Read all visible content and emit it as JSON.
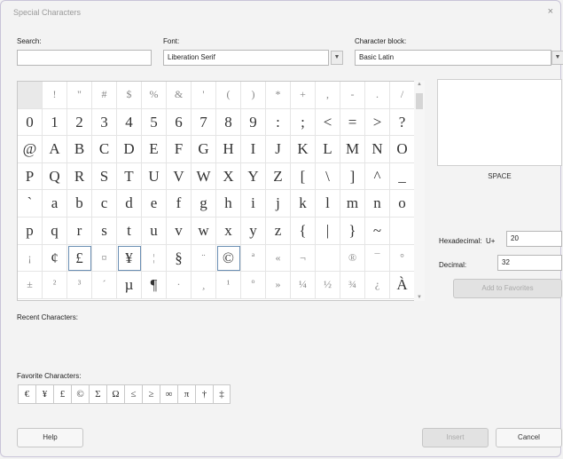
{
  "window": {
    "title": "Special Characters",
    "close_glyph": "×"
  },
  "search": {
    "label": "Search:",
    "value": ""
  },
  "font": {
    "label": "Font:",
    "value": "Liberation Serif"
  },
  "block": {
    "label": "Character block:",
    "value": "Basic Latin"
  },
  "grid": [
    [
      "",
      "!",
      "\"",
      "#",
      "$",
      "%",
      "&",
      "'",
      "(",
      ")",
      "*",
      "+",
      ",",
      "-",
      ".",
      "/"
    ],
    [
      "0",
      "1",
      "2",
      "3",
      "4",
      "5",
      "6",
      "7",
      "8",
      "9",
      ":",
      ";",
      "<",
      "=",
      ">",
      "?"
    ],
    [
      "@",
      "A",
      "B",
      "C",
      "D",
      "E",
      "F",
      "G",
      "H",
      "I",
      "J",
      "K",
      "L",
      "M",
      "N",
      "O"
    ],
    [
      "P",
      "Q",
      "R",
      "S",
      "T",
      "U",
      "V",
      "W",
      "X",
      "Y",
      "Z",
      "[",
      "\\",
      "]",
      "^",
      "_"
    ],
    [
      "`",
      "a",
      "b",
      "c",
      "d",
      "e",
      "f",
      "g",
      "h",
      "i",
      "j",
      "k",
      "l",
      "m",
      "n",
      "o"
    ],
    [
      "p",
      "q",
      "r",
      "s",
      "t",
      "u",
      "v",
      "w",
      "x",
      "y",
      "z",
      "{",
      "|",
      "}",
      "~",
      ""
    ],
    [
      "¡",
      "¢",
      "£",
      "¤",
      "¥",
      "¦",
      "§",
      "¨",
      "©",
      "ª",
      "«",
      "¬",
      "",
      "®",
      "¯",
      "°"
    ],
    [
      "±",
      "²",
      "³",
      "´",
      "µ",
      "¶",
      "·",
      "¸",
      "¹",
      "º",
      "»",
      "¼",
      "½",
      "¾",
      "¿",
      "À"
    ]
  ],
  "preview": {
    "char_name": "SPACE"
  },
  "hex": {
    "label": "Hexadecimal:",
    "prefix": "U+",
    "value": "20"
  },
  "dec": {
    "label": "Decimal:",
    "value": "32"
  },
  "add_favorites_label": "Add to Favorites",
  "recent": {
    "label": "Recent Characters:"
  },
  "favorites": {
    "label": "Favorite Characters:",
    "items": [
      "€",
      "¥",
      "£",
      "©",
      "Σ",
      "Ω",
      "≤",
      "≥",
      "∞",
      "π",
      "†",
      "‡"
    ]
  },
  "buttons": {
    "help": "Help",
    "insert": "Insert",
    "cancel": "Cancel"
  }
}
